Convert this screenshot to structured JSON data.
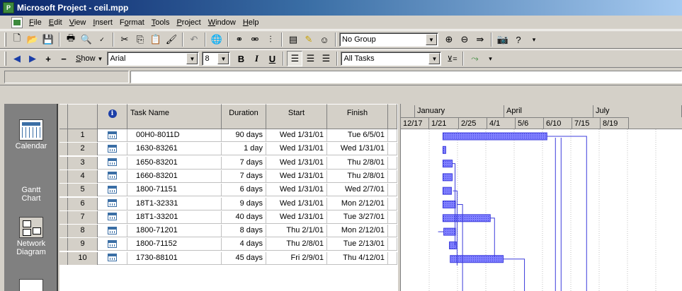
{
  "window": {
    "title": "Microsoft Project - ceil.mpp"
  },
  "menu": {
    "items": [
      {
        "label": "File",
        "key": "F",
        "rest": "ile"
      },
      {
        "label": "Edit",
        "key": "E",
        "rest": "dit"
      },
      {
        "label": "View",
        "key": "V",
        "rest": "iew"
      },
      {
        "label": "Insert",
        "key": "I",
        "rest": "nsert"
      },
      {
        "label": "Format",
        "key": "o",
        "pre": "F",
        "rest": "rmat"
      },
      {
        "label": "Tools",
        "key": "T",
        "rest": "ools"
      },
      {
        "label": "Project",
        "key": "P",
        "rest": "roject"
      },
      {
        "label": "Window",
        "key": "W",
        "rest": "indow"
      },
      {
        "label": "Help",
        "key": "H",
        "rest": "elp"
      }
    ]
  },
  "toolbar": {
    "group_value": "No Group",
    "show_label": "Show",
    "font_value": "Arial",
    "size_value": "8",
    "filter_value": "All Tasks",
    "bold": "B",
    "italic": "I",
    "underline": "U"
  },
  "viewbar": {
    "items": [
      {
        "label": "Calendar",
        "icon": "calendar-view-icon"
      },
      {
        "label": "Gantt Chart",
        "icon": "gantt-chart-view-icon",
        "active": true
      },
      {
        "label": "Network Diagram",
        "icon": "network-diagram-view-icon"
      }
    ]
  },
  "table": {
    "headers": {
      "task_name": "Task Name",
      "duration": "Duration",
      "start": "Start",
      "finish": "Finish"
    },
    "rows": [
      {
        "id": "1",
        "name": "00H0-8011D",
        "duration": "90 days",
        "start": "Wed 1/31/01",
        "finish": "Tue 6/5/01"
      },
      {
        "id": "2",
        "name": "1630-83261",
        "duration": "1 day",
        "start": "Wed 1/31/01",
        "finish": "Wed 1/31/01"
      },
      {
        "id": "3",
        "name": "1650-83201",
        "duration": "7 days",
        "start": "Wed 1/31/01",
        "finish": "Thu 2/8/01"
      },
      {
        "id": "4",
        "name": "1660-83201",
        "duration": "7 days",
        "start": "Wed 1/31/01",
        "finish": "Thu 2/8/01"
      },
      {
        "id": "5",
        "name": "1800-71151",
        "duration": "6 days",
        "start": "Wed 1/31/01",
        "finish": "Wed 2/7/01"
      },
      {
        "id": "6",
        "name": "18T1-32331",
        "duration": "9 days",
        "start": "Wed 1/31/01",
        "finish": "Mon 2/12/01"
      },
      {
        "id": "7",
        "name": "18T1-33201",
        "duration": "40 days",
        "start": "Wed 1/31/01",
        "finish": "Tue 3/27/01"
      },
      {
        "id": "8",
        "name": "1800-71201",
        "duration": "8 days",
        "start": "Thu 2/1/01",
        "finish": "Mon 2/12/01"
      },
      {
        "id": "9",
        "name": "1800-71152",
        "duration": "4 days",
        "start": "Thu 2/8/01",
        "finish": "Tue 2/13/01"
      },
      {
        "id": "10",
        "name": "1730-88101",
        "duration": "45 days",
        "start": "Fri 2/9/01",
        "finish": "Thu 4/12/01"
      }
    ]
  },
  "timescale": {
    "top": [
      "January",
      "April",
      "July"
    ],
    "bottom": [
      "12/17",
      "1/21",
      "2/25",
      "4/1",
      "5/6",
      "6/10",
      "7/15",
      "8/19"
    ]
  },
  "colors": {
    "bar": "#3c3cdc",
    "bar_fill": "#8080ff",
    "title_start": "#0a246a"
  }
}
